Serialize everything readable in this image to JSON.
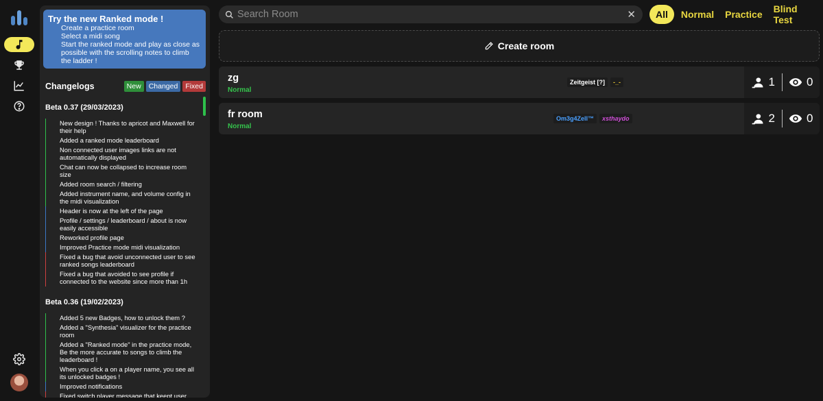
{
  "nav": {
    "items": [
      "music-icon",
      "trophy-icon",
      "chart-icon",
      "help-icon"
    ],
    "active": "music-icon",
    "bottom": [
      "gear-icon",
      "avatar"
    ]
  },
  "promo": {
    "title": "Try the new Ranked mode !",
    "lines": [
      "Create a practice room",
      "Select a midi song",
      "Start the ranked mode and play as close as possible with the scrolling notes to climb the ladder !"
    ]
  },
  "changelog": {
    "title": "Changelogs",
    "tags": {
      "new": "New",
      "changed": "Changed",
      "fixed": "Fixed"
    },
    "versions": [
      {
        "title": "Beta 0.37 (29/03/2023)",
        "entries": [
          {
            "type": "new",
            "text": "New design ! Thanks to apricot and Maxwell for their help"
          },
          {
            "type": "new",
            "text": "Added a ranked mode leaderboard"
          },
          {
            "type": "new",
            "text": "Non connected user images links are not automatically displayed"
          },
          {
            "type": "new",
            "text": "Chat can now be collapsed to increase room size"
          },
          {
            "type": "new",
            "text": "Added room search / filtering"
          },
          {
            "type": "new",
            "text": "Added instrument name, and volume config in the midi visualization"
          },
          {
            "type": "changed",
            "text": "Header is now at the left of the page"
          },
          {
            "type": "changed",
            "text": "Profile / settings / leaderboard / about is now easily accessible"
          },
          {
            "type": "changed",
            "text": "Reworked profile page"
          },
          {
            "type": "changed",
            "text": "Improved Practice mode midi visualization"
          },
          {
            "type": "fixed",
            "text": "Fixed a bug that avoid unconnected user to see ranked songs leaderboard"
          },
          {
            "type": "fixed",
            "text": "Fixed a bug that avoided to see profile if connected to the website since more than 1h"
          }
        ]
      },
      {
        "title": "Beta 0.36 (19/02/2023)",
        "entries": [
          {
            "type": "new",
            "text": "Added 5 new Badges, how to unlock them ?"
          },
          {
            "type": "new",
            "text": "Added a \"Synthesia\" visualizer for the practice room"
          },
          {
            "type": "new",
            "text": "Added a \"Ranked mode\" in the practice mode, Be the more accurate to songs to climb the leaderboard !"
          },
          {
            "type": "new",
            "text": "When you click a on a player name, you see all its unlocked badges !"
          },
          {
            "type": "changed",
            "text": "Improved notifications"
          },
          {
            "type": "fixed",
            "text": "Fixed switch player message that keept user color"
          }
        ]
      }
    ]
  },
  "search": {
    "placeholder": "Search Room",
    "value": ""
  },
  "filters": {
    "items": [
      "All",
      "Normal",
      "Practice",
      "Blind Test"
    ],
    "active": "All"
  },
  "create_room": {
    "label": "Create room"
  },
  "rooms": [
    {
      "name": "zg",
      "mode": "Normal",
      "players": [
        {
          "name": "Zeitgeist [?]",
          "color": "#ffffff"
        },
        {
          "name": "-_-",
          "color": "#e0c030"
        }
      ],
      "player_count": "1",
      "spectator_count": "0"
    },
    {
      "name": "fr room",
      "mode": "Normal",
      "players": [
        {
          "name": "Om3g4Zell™",
          "color": "#4aa0ff"
        },
        {
          "name": "xsthaydo",
          "color": "#d04fd8"
        }
      ],
      "player_count": "2",
      "spectator_count": "0"
    }
  ],
  "colors": {
    "accent_yellow": "#f3e85a",
    "filter_text": "#e8d640",
    "promo_blue": "#4678bd",
    "mode_green": "#35c24c",
    "tag_new": "#2f8f3a",
    "tag_changed": "#3c6aa5",
    "tag_fixed": "#b33a3a"
  }
}
